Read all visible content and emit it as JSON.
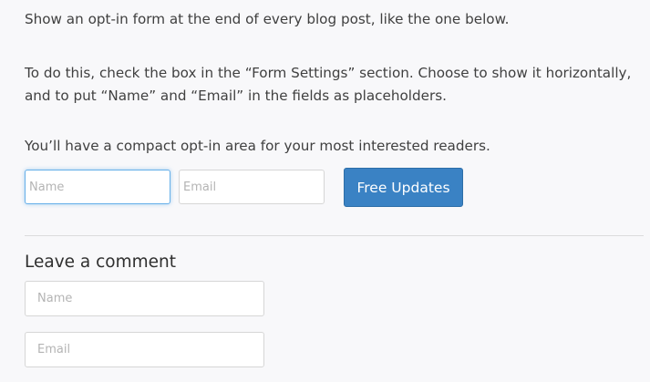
{
  "intro": {
    "line1": "Show an opt-in form at the end of every blog post, like the one below.",
    "line2": "To do this, check the box in the “Form Settings” section. Choose to show it horizontally, and to put “Name” and “Email” in the fields as placeholders.",
    "line3": "You’ll have a compact opt-in area for your most interested readers."
  },
  "optin": {
    "name_placeholder": "Name",
    "email_placeholder": "Email",
    "button_label": "Free Updates"
  },
  "comments": {
    "heading": "Leave a comment",
    "name_placeholder": "Name",
    "email_placeholder": "Email"
  }
}
